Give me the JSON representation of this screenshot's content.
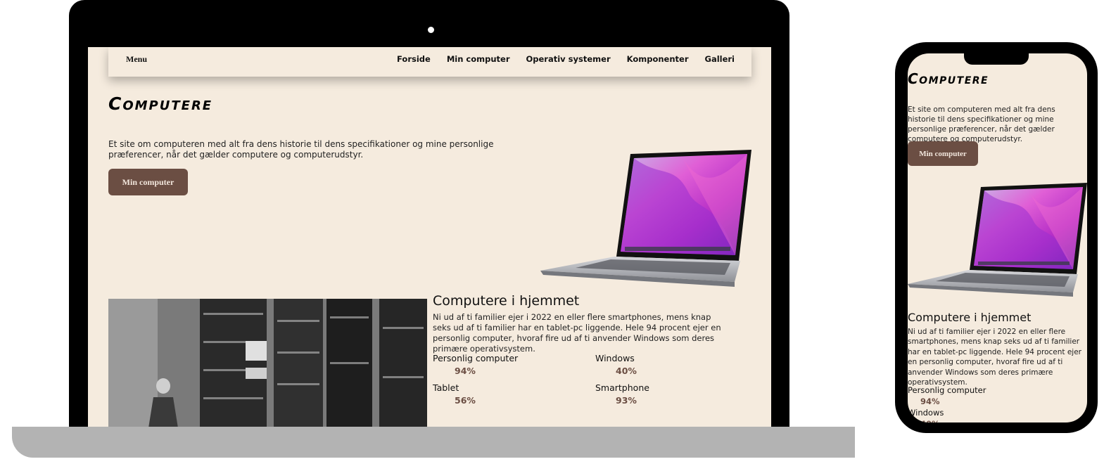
{
  "nav": {
    "menu_label": "Menu",
    "links": [
      "Forside",
      "Min computer",
      "Operativ systemer",
      "Komponenter",
      "Galleri"
    ]
  },
  "hero": {
    "title": "Computere",
    "text": "Et site om computeren med alt fra dens historie til dens specifikationer og mine personlige præferencer, når det gælder computere og computerudstyr.",
    "button_label": "Min computer"
  },
  "home_section": {
    "title": "Computere i hjemmet",
    "text": "Ni ud af ti familier ejer i 2022 en eller flere smartphones, mens knap seks ud af ti familier har en tablet-pc liggende. Hele 94 procent ejer en personlig computer, hvoraf fire ud af ti anvender Windows som deres primære operativsystem.",
    "stats": [
      {
        "label": "Personlig computer",
        "value": "94%"
      },
      {
        "label": "Windows",
        "value": "40%"
      },
      {
        "label": "Tablet",
        "value": "56%"
      },
      {
        "label": "Smartphone",
        "value": "93%"
      }
    ]
  },
  "colors": {
    "page_background": "#f5ebde",
    "button_background": "#6b4e43",
    "stat_value": "#6b4e43"
  }
}
